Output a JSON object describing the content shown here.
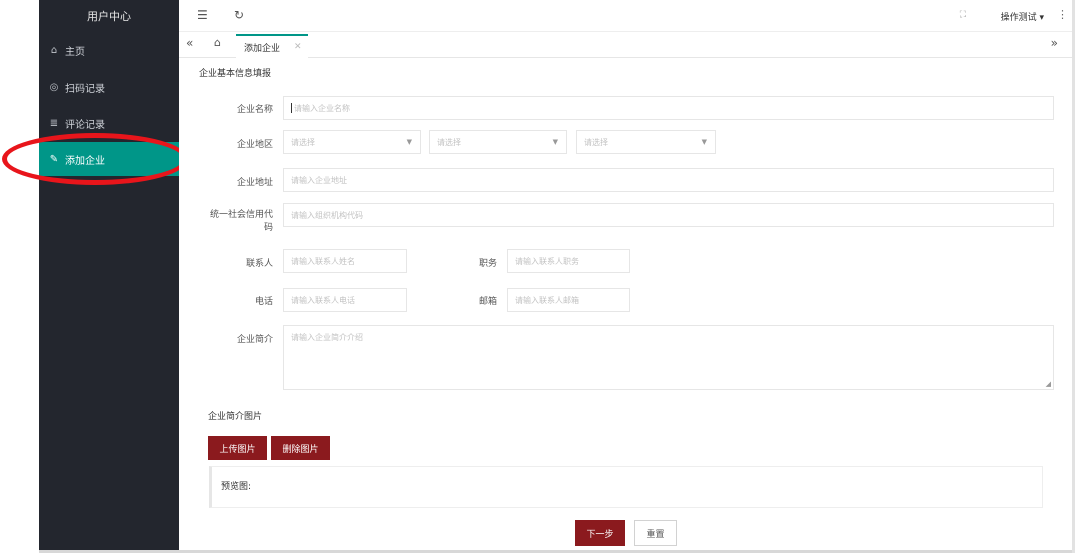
{
  "sidebar": {
    "title": "用户中心",
    "items": [
      {
        "label": "主页",
        "icon": "home-icon"
      },
      {
        "label": "扫码记录",
        "icon": "scan-icon"
      },
      {
        "label": "评论记录",
        "icon": "list-icon"
      },
      {
        "label": "添加企业",
        "icon": "edit-icon",
        "active": true
      }
    ]
  },
  "topbar": {
    "user": "操作测试"
  },
  "tabs": [
    {
      "label": "添加企业"
    }
  ],
  "form": {
    "section_title": "企业基本信息填报",
    "company_name": {
      "label": "企业名称",
      "placeholder": "请输入企业名称"
    },
    "region": {
      "label": "企业地区",
      "selects": [
        "请选择",
        "请选择",
        "请选择"
      ]
    },
    "address": {
      "label": "企业地址",
      "placeholder": "请输入企业地址"
    },
    "credit_code": {
      "label": "统一社会信用代码",
      "placeholder": "请输入组织机构代码"
    },
    "contact": {
      "label": "联系人",
      "placeholder": "请输入联系人姓名"
    },
    "position": {
      "label": "职务",
      "placeholder": "请输入联系人职务"
    },
    "phone": {
      "label": "电话",
      "placeholder": "请输入联系人电话"
    },
    "email": {
      "label": "邮箱",
      "placeholder": "请输入联系人邮箱"
    },
    "intro": {
      "label": "企业简介",
      "placeholder": "请输入企业简介介绍"
    },
    "images": {
      "label": "企业简介图片",
      "upload_label": "上传图片",
      "delete_label": "删除图片",
      "preview_label": "预览图:"
    }
  },
  "footer": {
    "next_label": "下一步",
    "reset_label": "重置"
  },
  "colors": {
    "sidebar_bg": "#23262e",
    "active_item": "#009688",
    "primary_button": "#8b1a1e",
    "annotation": "#e8151b"
  }
}
